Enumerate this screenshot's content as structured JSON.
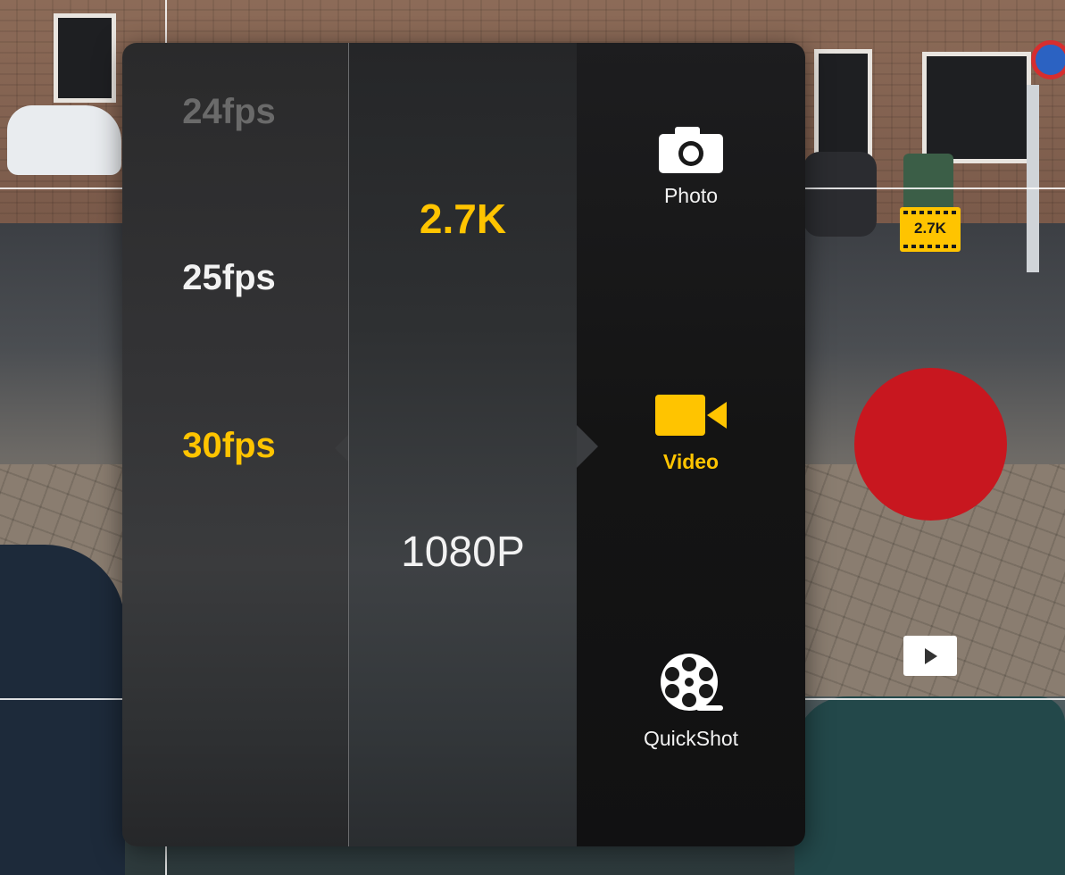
{
  "frame_rates": {
    "items": [
      {
        "label": "24fps",
        "state": "disabled"
      },
      {
        "label": "25fps",
        "state": "available"
      },
      {
        "label": "30fps",
        "state": "selected"
      }
    ]
  },
  "resolutions": {
    "items": [
      {
        "label": "2.7K",
        "state": "selected"
      },
      {
        "label": "1080P",
        "state": "available"
      }
    ]
  },
  "modes": {
    "items": [
      {
        "label": "Photo",
        "icon": "camera-icon",
        "state": "available"
      },
      {
        "label": "Video",
        "icon": "video-camera-icon",
        "state": "selected"
      },
      {
        "label": "QuickShot",
        "icon": "film-reel-icon",
        "state": "available"
      }
    ]
  },
  "status": {
    "resolution_badge": "2.7K"
  },
  "controls": {
    "record_icon": "record-button",
    "playback_icon": "play-icon"
  },
  "colors": {
    "accent": "#ffc400",
    "record": "#c8171f",
    "text": "#f2f2f2",
    "disabled": "#6a6a6a"
  }
}
